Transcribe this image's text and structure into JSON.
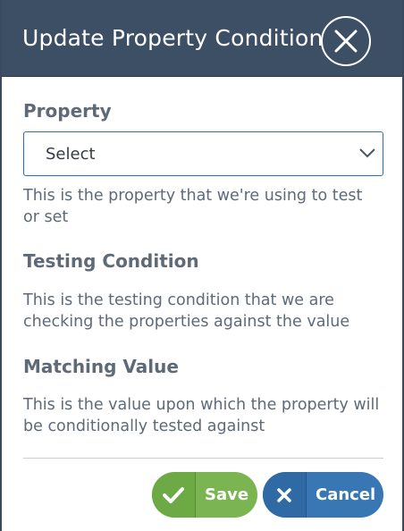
{
  "dialog": {
    "title": "Update Property Condition",
    "close_icon": "close-icon"
  },
  "fields": {
    "property": {
      "label": "Property",
      "select_value": "Select",
      "help": "This is the property that we're using to test or set"
    },
    "testing_condition": {
      "label": "Testing Condition",
      "help": "This is the testing condition that we are checking the properties against the value"
    },
    "matching_value": {
      "label": "Matching Value",
      "help": "This is the value upon which the property will be conditionally tested against"
    }
  },
  "actions": {
    "save_label": "Save",
    "save_icon": "checkmark-icon",
    "cancel_label": "Cancel",
    "cancel_icon": "x-icon"
  },
  "colors": {
    "header_bg": "#3d4f65",
    "save_bg": "#7ab552",
    "cancel_bg": "#3977b4",
    "select_border": "#2f6fa8",
    "text": "#5f6a78"
  }
}
